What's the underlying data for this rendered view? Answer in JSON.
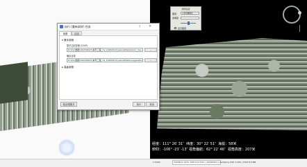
{
  "dialog": {
    "title": "执行 [重新采样] 任务",
    "help_label": "?",
    "close_label": "×",
    "tabs": [
      {
        "label": "参数"
      },
      {
        "label": "日志"
      }
    ],
    "section_basic": "▾ 基本参数",
    "input_label": "数字正射影像 (DOM)",
    "input_value": "D:\\\\fv\\\\数据\\\\20250613\\\\青年工程_YG_20250613\\\\rebuildData\\\\dom_tran",
    "output_label": "输出目录",
    "output_value": "D:\\\\fv\\\\数据\\\\20250613\\\\青年工程_YG_20250613\\\\rebuildData\\\\vegetation",
    "browse_label": "...",
    "section_advanced": "▸ 高级参数",
    "batch_button": "批处理模式",
    "run_button": "执行",
    "close_button": "关闭"
  },
  "layer_panel": {
    "title": "透明设置",
    "label_layer": "图层:",
    "layer_value": "正射影像图层",
    "label_opacity": "透明度:",
    "checkbox_label": "显示图层"
  },
  "readout": {
    "line1": "经度：111° 26′ 31″  纬度：30° 22′ 51″  海拔：58米",
    "line2": "俯仰：-106° -23′ -13″ 视角偏航：62° 22′ 46″  视角高度：207米"
  },
  "statusbar": {
    "scale": "1:5000",
    "info": "5400612.1470 3387170.0321 | 20240601 | Sampling GSD 1:200 | Total 8.8 MB"
  },
  "colors": {
    "dialog_icon": "#3d73c9",
    "right_panel": "#000000",
    "left_canvas": "#fafafa"
  }
}
